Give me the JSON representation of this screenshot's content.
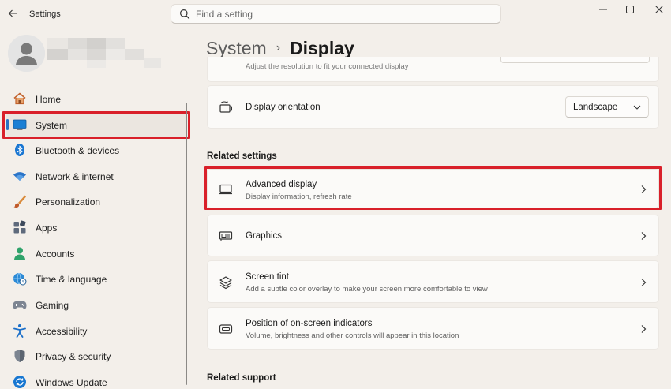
{
  "window": {
    "title": "Settings",
    "search_placeholder": "Find a setting"
  },
  "nav": {
    "items": [
      {
        "label": "Home",
        "icon": "home-icon"
      },
      {
        "label": "System",
        "icon": "system-icon",
        "selected": true
      },
      {
        "label": "Bluetooth & devices",
        "icon": "bluetooth-icon"
      },
      {
        "label": "Network & internet",
        "icon": "wifi-icon"
      },
      {
        "label": "Personalization",
        "icon": "brush-icon"
      },
      {
        "label": "Apps",
        "icon": "apps-icon"
      },
      {
        "label": "Accounts",
        "icon": "accounts-icon"
      },
      {
        "label": "Time & language",
        "icon": "globe-clock-icon"
      },
      {
        "label": "Gaming",
        "icon": "gamepad-icon"
      },
      {
        "label": "Accessibility",
        "icon": "accessibility-icon"
      },
      {
        "label": "Privacy & security",
        "icon": "shield-icon"
      },
      {
        "label": "Windows Update",
        "icon": "update-icon"
      }
    ]
  },
  "breadcrumb": {
    "parent": "System",
    "separator": "›",
    "current": "Display"
  },
  "main": {
    "partial_card_subtitle": "Adjust the resolution to fit your connected display",
    "orientation": {
      "title": "Display orientation",
      "value": "Landscape"
    },
    "related_settings_heading": "Related settings",
    "related": [
      {
        "title": "Advanced display",
        "subtitle": "Display information, refresh rate",
        "icon": "monitor-icon"
      },
      {
        "title": "Graphics",
        "subtitle": "",
        "icon": "graphics-card-icon"
      },
      {
        "title": "Screen tint",
        "subtitle": "Add a subtle color overlay to make your screen more comfortable to view",
        "icon": "layers-icon"
      },
      {
        "title": "Position of on-screen indicators",
        "subtitle": "Volume, brightness and other controls will appear in this location",
        "icon": "indicator-icon"
      }
    ],
    "related_support_heading": "Related support"
  },
  "colors": {
    "accent": "#2a73c4",
    "highlight": "#d9202a",
    "background": "#f3efea",
    "card": "#fbfaf8"
  }
}
